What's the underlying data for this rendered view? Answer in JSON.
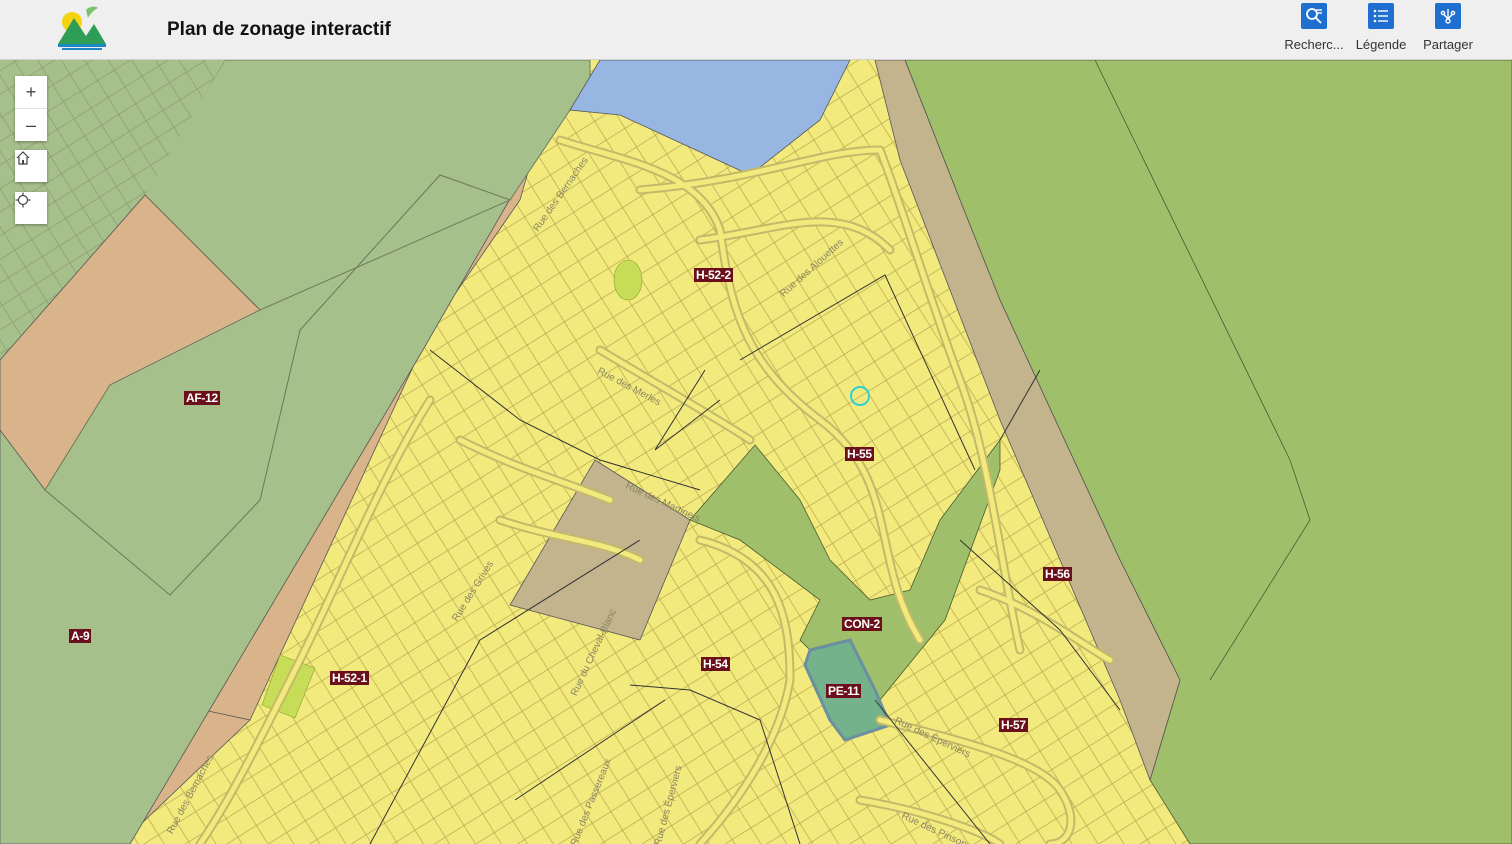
{
  "header": {
    "title": "Plan de zonage interactif",
    "tools": [
      {
        "label": "Recherc...",
        "icon": "search-list-icon"
      },
      {
        "label": "Légende",
        "icon": "legend-list-icon"
      },
      {
        "label": "Partager",
        "icon": "share-icon"
      }
    ]
  },
  "map_controls": {
    "zoom_in": "+",
    "zoom_out": "–",
    "home_icon": "home-icon",
    "locate_icon": "locate-icon"
  },
  "zones": [
    "H-52-2",
    "AF-12",
    "H-55",
    "H-56",
    "A-9",
    "CON-2",
    "H-54",
    "H-52-1",
    "PE-11",
    "H-57"
  ],
  "streets": [
    "Rue des Bernaches",
    "Rue des Alouettes",
    "Rue des Merles",
    "Rue des Martinets",
    "Rue des Grives",
    "Rue du Cheval-Blanc",
    "Rue des Éperviers",
    "Rue des Bernaches",
    "Rue des Passereaux",
    "Rue des Éperviers",
    "Rue des Pinsons"
  ],
  "colors": {
    "residential": "#f3ea7e",
    "agricultural": "#d9b48a",
    "agroforest": "#a6c08c",
    "conservation": "#9fbf6a",
    "public": "#74b28c",
    "industrial": "#c3b48d",
    "water": "#97b7e2",
    "label_bg": "#6b0f1a",
    "tool_icon": "#1f6fd1"
  }
}
